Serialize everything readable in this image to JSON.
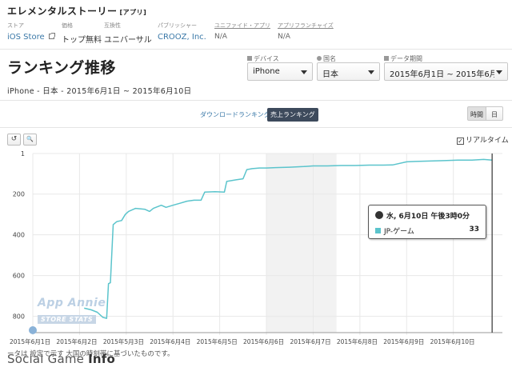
{
  "app": {
    "title": "エレメンタルストーリー",
    "tag": "[アプリ]"
  },
  "meta": [
    {
      "label": "ストア",
      "value": "iOS Store",
      "kind": "link"
    },
    {
      "label": "価格",
      "value": "トップ無料",
      "kind": "plain"
    },
    {
      "label": "互換性",
      "value": "ユニバーサル",
      "kind": "plain"
    },
    {
      "label": "パブリッシャー",
      "value": "CROOZ, Inc.",
      "kind": "link"
    },
    {
      "label": "ユニファイド・アプリ",
      "value": "N/A",
      "kind": "muted"
    },
    {
      "label": "アプリフランチャイズ",
      "value": "N/A",
      "kind": "muted"
    }
  ],
  "page": {
    "title": "ランキング推移",
    "subtitle": "iPhone - 日本 - 2015年6月1日 ~ 2015年6月10日"
  },
  "filters": {
    "device": {
      "label": "デバイス",
      "value": "iPhone"
    },
    "country": {
      "label": "国名",
      "value": "日本"
    },
    "period": {
      "label": "データ期間",
      "value": "2015年6月1日 ~ 2015年6月..."
    }
  },
  "ranking_tabs": {
    "download": "ダウンロードランキング",
    "revenue": "売上ランキング"
  },
  "granularity": {
    "hour": "時間",
    "day": "日"
  },
  "tools": {
    "reset": "↺",
    "zoom": "🔍"
  },
  "realtime": {
    "label": "リアルタイム",
    "check": "✓"
  },
  "watermark": {
    "line1": "App Annie",
    "line2": "STORE STATS"
  },
  "tooltip": {
    "date": "水, 6月10日 午後3時0分",
    "series": "JP-ゲーム",
    "value": "33"
  },
  "note": "ータは          設定で示す      大国の時刻帯に基づいたものです。",
  "brand": {
    "a": "Social Game ",
    "b": "Info"
  },
  "colors": {
    "line": "#5bc4cc",
    "highlight": "#f2f2f2"
  },
  "chart_data": {
    "type": "line",
    "title": "",
    "xlabel": "",
    "ylabel": "",
    "y_reversed": true,
    "ylim": [
      1,
      880
    ],
    "yticks": [
      1,
      200,
      400,
      600,
      800
    ],
    "x_labels": [
      "2015年6月1日",
      "2015年6月2日",
      "2015年5月3日",
      "2015年6月4日",
      "2015年6月5日",
      "2015年6月6日",
      "2015年6月7日",
      "2015年6月8日",
      "2015年6月9日",
      "2015年6月10日"
    ],
    "xlim": [
      1,
      11.05
    ],
    "series": [
      {
        "name": "JP-ゲーム",
        "points": [
          [
            2.1,
            760
          ],
          [
            2.25,
            768
          ],
          [
            2.38,
            780
          ],
          [
            2.5,
            805
          ],
          [
            2.58,
            810
          ],
          [
            2.62,
            640
          ],
          [
            2.66,
            635
          ],
          [
            2.72,
            350
          ],
          [
            2.8,
            335
          ],
          [
            2.9,
            330
          ],
          [
            2.98,
            300
          ],
          [
            3.05,
            285
          ],
          [
            3.2,
            270
          ],
          [
            3.4,
            275
          ],
          [
            3.5,
            285
          ],
          [
            3.58,
            270
          ],
          [
            3.75,
            255
          ],
          [
            3.85,
            265
          ],
          [
            4.0,
            255
          ],
          [
            4.15,
            245
          ],
          [
            4.3,
            235
          ],
          [
            4.45,
            230
          ],
          [
            4.6,
            230
          ],
          [
            4.68,
            190
          ],
          [
            4.9,
            188
          ],
          [
            5.1,
            190
          ],
          [
            5.15,
            138
          ],
          [
            5.35,
            130
          ],
          [
            5.5,
            125
          ],
          [
            5.58,
            80
          ],
          [
            5.7,
            75
          ],
          [
            5.85,
            72
          ],
          [
            6.0,
            72
          ],
          [
            6.2,
            70
          ],
          [
            6.5,
            68
          ],
          [
            6.8,
            65
          ],
          [
            7.0,
            62
          ],
          [
            7.3,
            62
          ],
          [
            7.6,
            60
          ],
          [
            7.9,
            60
          ],
          [
            8.2,
            58
          ],
          [
            8.5,
            58
          ],
          [
            8.7,
            57
          ],
          [
            9.0,
            42
          ],
          [
            9.2,
            40
          ],
          [
            9.5,
            38
          ],
          [
            9.8,
            36
          ],
          [
            10.1,
            33
          ],
          [
            10.4,
            33
          ],
          [
            10.65,
            30
          ],
          [
            10.83,
            33
          ]
        ]
      }
    ],
    "highlight_x": [
      6,
      7.5
    ],
    "crosshair_x": 10.83
  }
}
